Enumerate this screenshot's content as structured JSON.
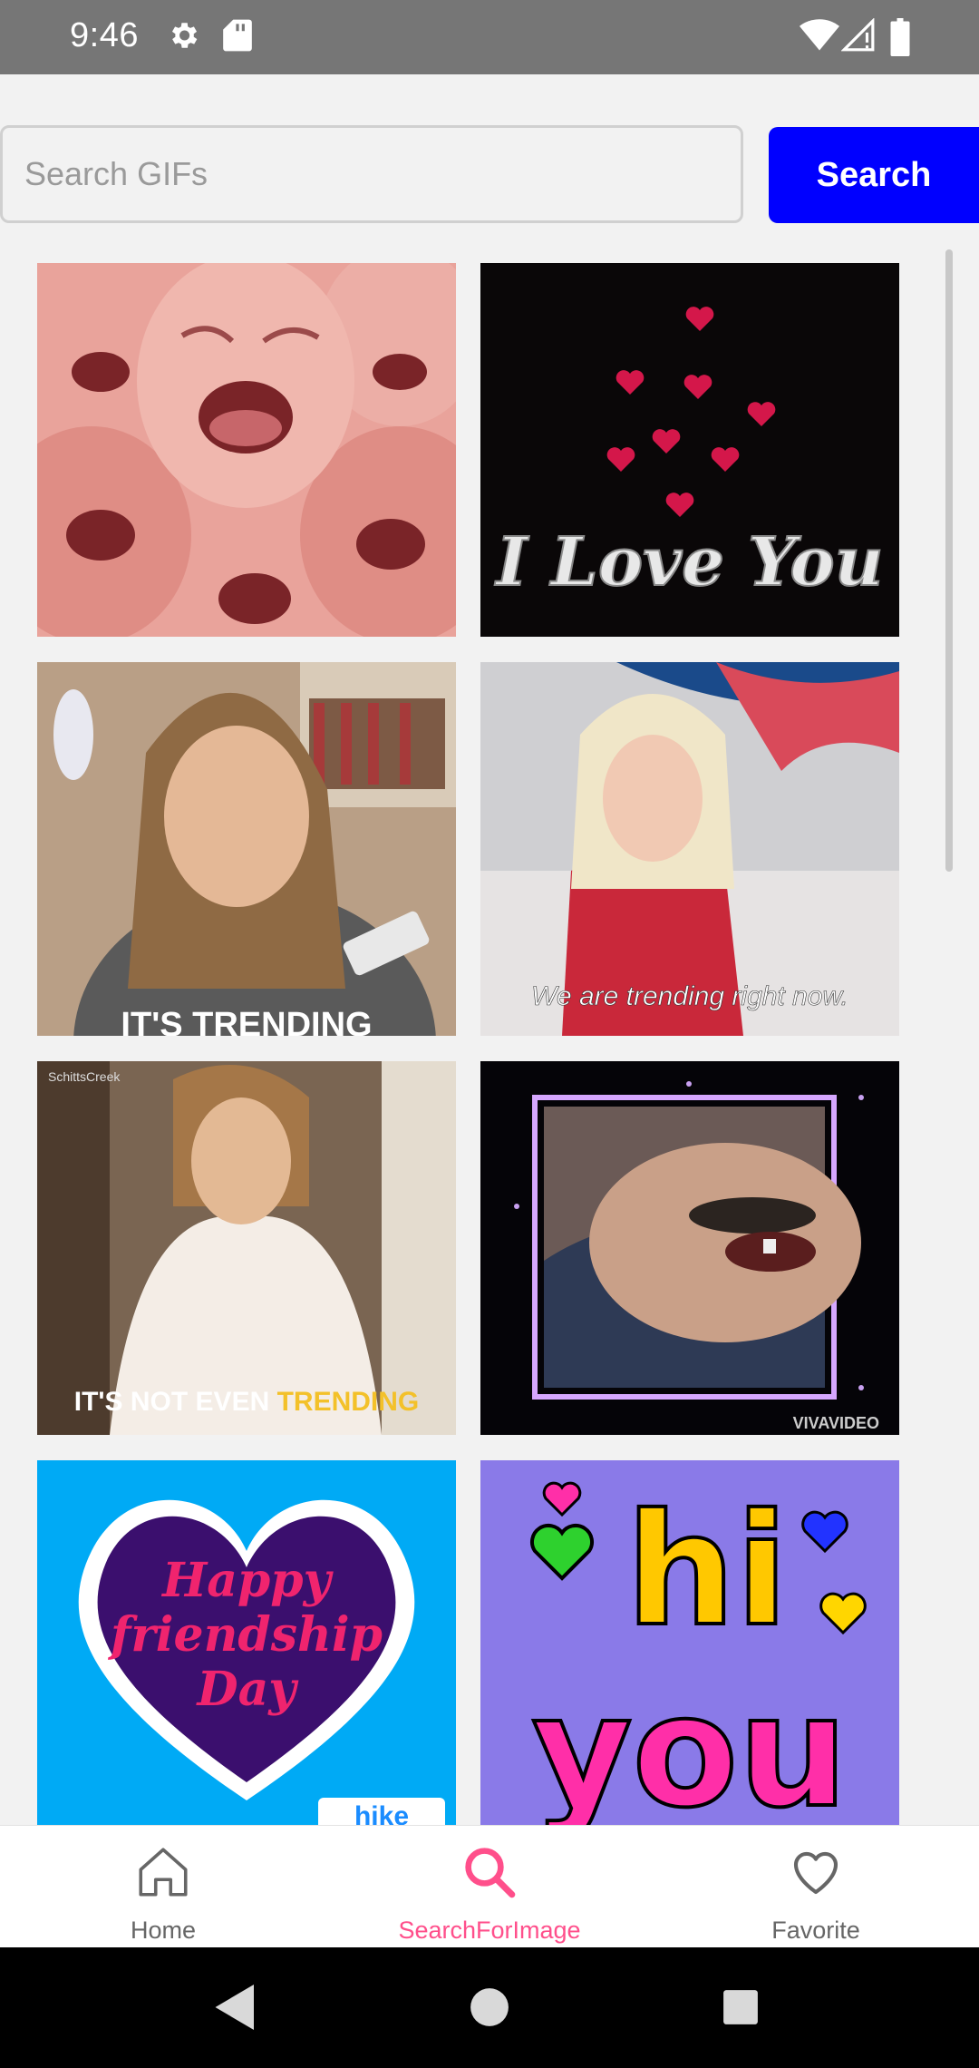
{
  "status_bar": {
    "time": "9:46",
    "icons": [
      "gear-icon",
      "sd-card-icon",
      "wifi-icon",
      "signal-icon",
      "battery-icon"
    ]
  },
  "search": {
    "placeholder": "Search GIFs",
    "value": "",
    "button_label": "Search",
    "button_color": "#0000ff"
  },
  "gifs": [
    {
      "caption": ""
    },
    {
      "caption": "I Love You"
    },
    {
      "caption": "IT'S TRENDING"
    },
    {
      "caption": "We are trending right now."
    },
    {
      "caption_prefix": "IT'S NOT EVEN ",
      "caption_highlight": "TRENDING",
      "watermark": "SchittsCreek"
    },
    {
      "caption": "",
      "watermark": "VIVAVIDEO"
    },
    {
      "caption_lines": [
        "Happy",
        "friendship",
        "Day"
      ],
      "watermark": "hike"
    },
    {
      "caption_lines": [
        "hi",
        "you"
      ]
    }
  ],
  "bottom_nav": {
    "items": [
      {
        "label": "Home",
        "icon": "home-icon"
      },
      {
        "label": "SearchForImage",
        "icon": "search-icon"
      },
      {
        "label": "Favorite",
        "icon": "heart-icon"
      }
    ],
    "active_color": "#ff4f8b"
  },
  "system_nav": [
    "back-icon",
    "home-circle-icon",
    "recents-icon"
  ]
}
